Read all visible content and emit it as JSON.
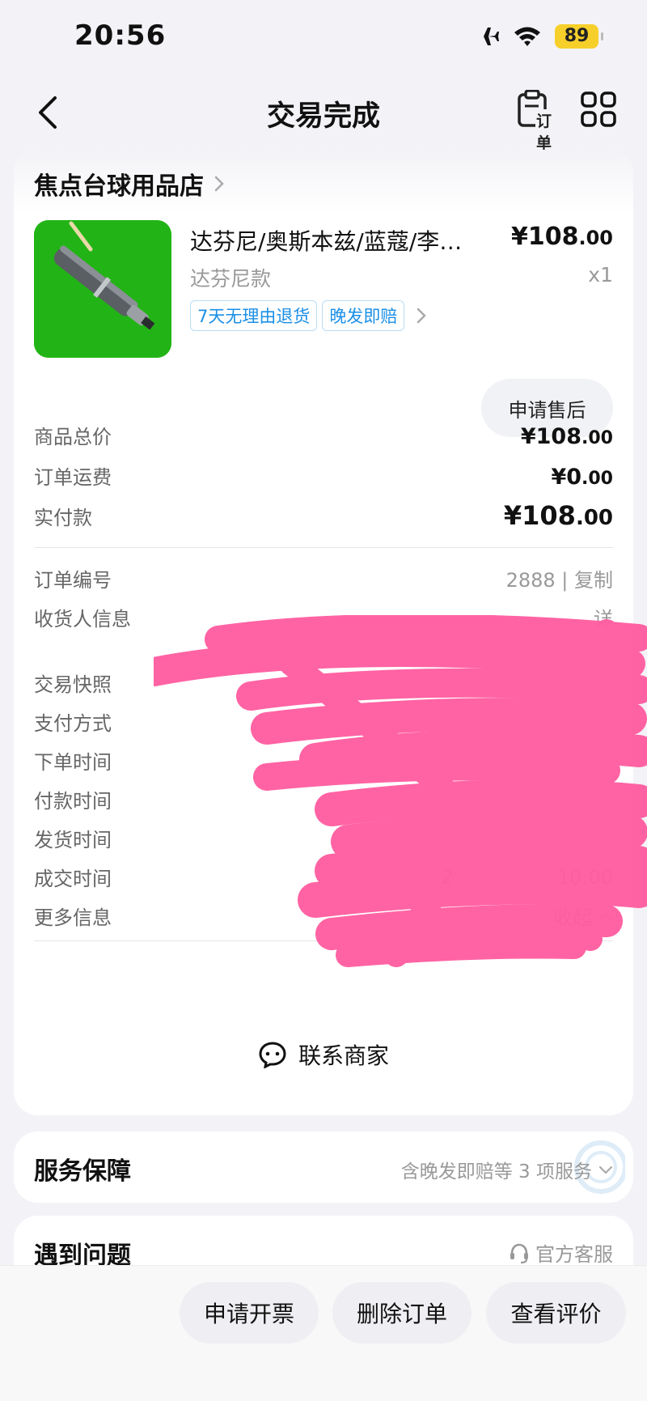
{
  "status": {
    "time": "20:56",
    "battery": "89"
  },
  "nav": {
    "title": "交易完成",
    "order_label": "订单"
  },
  "shop": {
    "name": "焦点台球用品店"
  },
  "product": {
    "title": "达芬尼/奥斯本兹/蓝蔻/李…",
    "price_int": "¥108",
    "price_dec": ".00",
    "variant": "达芬尼款",
    "qty": "x1",
    "tags": [
      "7天无理由退货",
      "晚发即赔"
    ],
    "aftersale": "申请售后"
  },
  "prices": {
    "goods_label": "商品总价",
    "goods_int": "¥108",
    "goods_dec": ".00",
    "shipping_label": "订单运费",
    "shipping_int": "¥0",
    "shipping_dec": ".00",
    "paid_label": "实付款",
    "paid_int": "¥108",
    "paid_dec": ".00"
  },
  "info": {
    "order_no_label": "订单编号",
    "order_no_partial": "2888 | 复制",
    "receiver_label": "收货人信息",
    "receiver_partial": "详",
    "snapshot_label": "交易快照",
    "pay_method_label": "支付方式",
    "order_time_label": "下单时间",
    "pay_time_label": "付款时间",
    "ship_time_label": "发货时间",
    "deal_time_label": "成交时间",
    "deal_time_partial": "2",
    "deal_time_partial_end": "10:00",
    "more_label": "更多信息",
    "collapse_label": "收起"
  },
  "contact": {
    "label": "联系商家"
  },
  "service": {
    "title": "服务保障",
    "summary": "含晚发即赔等 3 项服务"
  },
  "problem": {
    "title": "遇到问题",
    "cs": "官方客服"
  },
  "bottom": {
    "invoice": "申请开票",
    "delete": "删除订单",
    "review": "查看评价"
  },
  "colors": {
    "accent_blue": "#1a8fe6",
    "scribble_pink": "#ff5ea1",
    "battery": "#f7cf2a",
    "product_bg": "#22b416"
  },
  "icons": [
    "airplane-icon",
    "wifi-icon",
    "back-icon",
    "order-clipboard-icon",
    "grid-icon",
    "chevron-right-icon",
    "chevron-up-icon",
    "chevron-down-icon",
    "chat-icon",
    "headset-icon"
  ]
}
